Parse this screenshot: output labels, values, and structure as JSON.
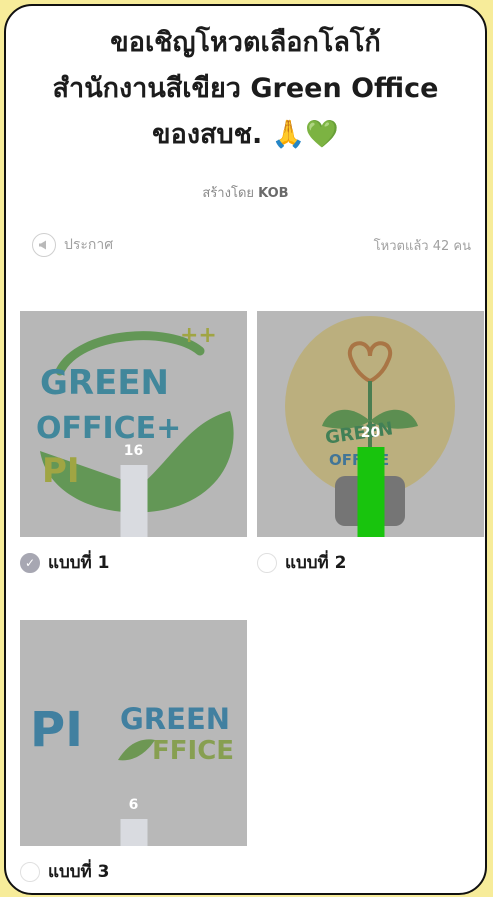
{
  "title": {
    "line1": "ขอเชิญโหวตเลือกโลโก้",
    "line2": "สำนักงานสีเขียว Green Office",
    "line3": "ของสบช. ",
    "emoji_pray": "🙏",
    "emoji_heart": "💚"
  },
  "creator": {
    "prefix": "สร้างโดย ",
    "name": "KOB"
  },
  "announcement_label": "ประกาศ",
  "voted_text": "โหวตแล้ว 42 คน",
  "options": [
    {
      "label": "แบบที่ 1",
      "votes": "16",
      "vote_share": 0.381,
      "selected": true,
      "logo": {
        "a": "GREEN",
        "b": "OFFICE+",
        "c": "PI",
        "d": "++"
      }
    },
    {
      "label": "แบบที่ 2",
      "votes": "20",
      "vote_share": 0.476,
      "selected": false,
      "leading": true,
      "logo": {
        "a": "GREEN",
        "b": "OFFICE"
      }
    },
    {
      "label": "แบบที่ 3",
      "votes": "6",
      "vote_share": 0.143,
      "selected": false,
      "logo": {
        "a": "PI",
        "b": "GREEN",
        "c": "FFICE"
      }
    }
  ],
  "colors": {
    "background": "#f7ec9a",
    "leading_bar": "#18c40d",
    "bar": "#d9dbe0"
  }
}
